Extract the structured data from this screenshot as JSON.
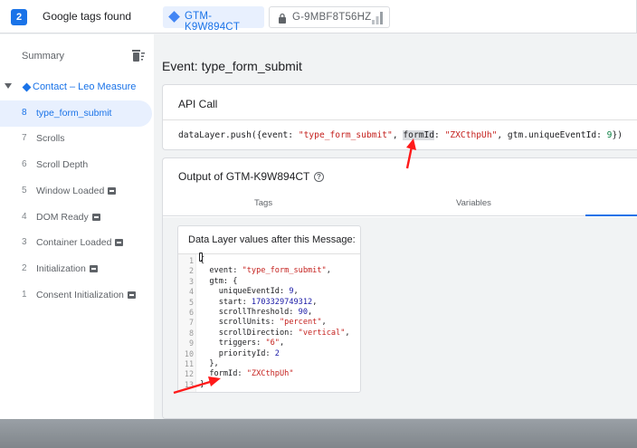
{
  "topbar": {
    "tag_count": "2",
    "tags_found_label": "Google tags found",
    "tabs": [
      {
        "label": "GTM-K9W894CT",
        "active": true
      },
      {
        "label": "G-9MBF8T56HZ",
        "active": false
      }
    ]
  },
  "sidebar": {
    "summary_label": "Summary",
    "container_label": "Contact – Leo Measure",
    "events": [
      {
        "num": "8",
        "label": "type_form_submit",
        "active": true,
        "code_icon": false
      },
      {
        "num": "7",
        "label": "Scrolls",
        "active": false,
        "code_icon": false
      },
      {
        "num": "6",
        "label": "Scroll Depth",
        "active": false,
        "code_icon": false
      },
      {
        "num": "5",
        "label": "Window Loaded",
        "active": false,
        "code_icon": true
      },
      {
        "num": "4",
        "label": "DOM Ready",
        "active": false,
        "code_icon": true
      },
      {
        "num": "3",
        "label": "Container Loaded",
        "active": false,
        "code_icon": true
      },
      {
        "num": "2",
        "label": "Initialization",
        "active": false,
        "code_icon": true
      },
      {
        "num": "1",
        "label": "Consent Initialization",
        "active": false,
        "code_icon": true
      }
    ]
  },
  "main": {
    "event_title": "Event: type_form_submit",
    "api_call": {
      "header": "API Call",
      "code_parts": [
        {
          "t": "dataLayer.push({event: ",
          "c": ""
        },
        {
          "t": "\"type_form_submit\"",
          "c": "str"
        },
        {
          "t": ", ",
          "c": ""
        },
        {
          "t": "formId",
          "c": "hl"
        },
        {
          "t": ": ",
          "c": ""
        },
        {
          "t": "\"ZXCthpUh\"",
          "c": "str"
        },
        {
          "t": ", gtm.uniqueEventId: ",
          "c": ""
        },
        {
          "t": "9",
          "c": "num"
        },
        {
          "t": "})",
          "c": ""
        }
      ]
    },
    "output": {
      "header": "Output of GTM-K9W894CT",
      "tabs": [
        "Tags",
        "Variables"
      ],
      "datalayer_header": "Data Layer values after this Message:",
      "code_lines": [
        [
          {
            "t": "{",
            "c": ""
          }
        ],
        [
          {
            "t": "  event: ",
            "c": ""
          },
          {
            "t": "\"type_form_submit\"",
            "c": "s"
          },
          {
            "t": ",",
            "c": ""
          }
        ],
        [
          {
            "t": "  gtm: {",
            "c": ""
          }
        ],
        [
          {
            "t": "    uniqueEventId: ",
            "c": ""
          },
          {
            "t": "9",
            "c": "n"
          },
          {
            "t": ",",
            "c": ""
          }
        ],
        [
          {
            "t": "    start: ",
            "c": ""
          },
          {
            "t": "1703329749312",
            "c": "n"
          },
          {
            "t": ",",
            "c": ""
          }
        ],
        [
          {
            "t": "    scrollThreshold: ",
            "c": ""
          },
          {
            "t": "90",
            "c": "n"
          },
          {
            "t": ",",
            "c": ""
          }
        ],
        [
          {
            "t": "    scrollUnits: ",
            "c": ""
          },
          {
            "t": "\"percent\"",
            "c": "s"
          },
          {
            "t": ",",
            "c": ""
          }
        ],
        [
          {
            "t": "    scrollDirection: ",
            "c": ""
          },
          {
            "t": "\"vertical\"",
            "c": "s"
          },
          {
            "t": ",",
            "c": ""
          }
        ],
        [
          {
            "t": "    triggers: ",
            "c": ""
          },
          {
            "t": "\"6\"",
            "c": "s"
          },
          {
            "t": ",",
            "c": ""
          }
        ],
        [
          {
            "t": "    priorityId: ",
            "c": ""
          },
          {
            "t": "2",
            "c": "n"
          }
        ],
        [
          {
            "t": "  },",
            "c": ""
          }
        ],
        [
          {
            "t": "  formId: ",
            "c": ""
          },
          {
            "t": "\"ZXCthpUh\"",
            "c": "s"
          }
        ],
        [
          {
            "t": "}",
            "c": ""
          }
        ]
      ]
    }
  },
  "colors": {
    "accent": "#1a73e8",
    "annotation_arrow": "#ff1a1a",
    "string": "#c5221f"
  },
  "icons": [
    "tag-diamond-icon",
    "lock-icon",
    "signal-bars-icon",
    "trash-sweep-icon",
    "help-circle-icon",
    "code-icon",
    "text-cursor-icon",
    "red-arrow-annotation"
  ]
}
